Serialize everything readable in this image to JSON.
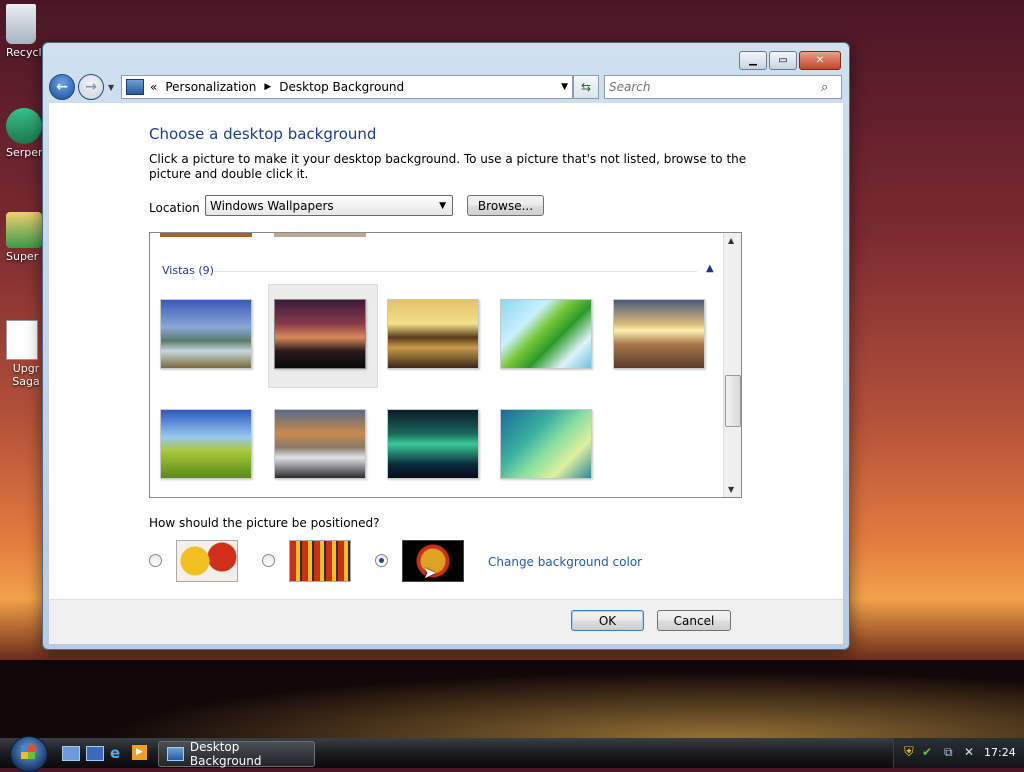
{
  "desktop": {
    "icons": [
      {
        "label": "Recycl"
      },
      {
        "label": "Serpen"
      },
      {
        "label": "Super"
      },
      {
        "label": "Upgr Saga"
      }
    ]
  },
  "window": {
    "address": {
      "chevron": "«",
      "crumbs": [
        "Personalization",
        "Desktop Background"
      ]
    },
    "search": {
      "placeholder": "Search"
    },
    "heading": "Choose a desktop background",
    "description": "Click a picture to make it your desktop background. To use a picture that's not listed, browse to the picture and double click it.",
    "location_label": "Location",
    "location_value": "Windows Wallpapers",
    "browse_label": "Browse...",
    "group": {
      "label": "Vistas (9)"
    },
    "wallpapers": [
      {
        "name": "vista-lake-mountains"
      },
      {
        "name": "vista-dusk-silhouette",
        "selected": true
      },
      {
        "name": "vista-rocks-sunset"
      },
      {
        "name": "vista-palm-leaf"
      },
      {
        "name": "vista-grass-sunset"
      },
      {
        "name": "vista-green-hills"
      },
      {
        "name": "vista-rock-pool"
      },
      {
        "name": "vista-aurora"
      },
      {
        "name": "vista-aero-green"
      }
    ],
    "position_question": "How should the picture be positioned?",
    "position_options": [
      {
        "name": "fit-to-screen",
        "selected": false
      },
      {
        "name": "tile",
        "selected": false
      },
      {
        "name": "center",
        "selected": true
      }
    ],
    "change_color_link": "Change background color",
    "ok_label": "OK",
    "cancel_label": "Cancel"
  },
  "taskbar": {
    "task_label": "Desktop Background",
    "clock": "17:24"
  }
}
